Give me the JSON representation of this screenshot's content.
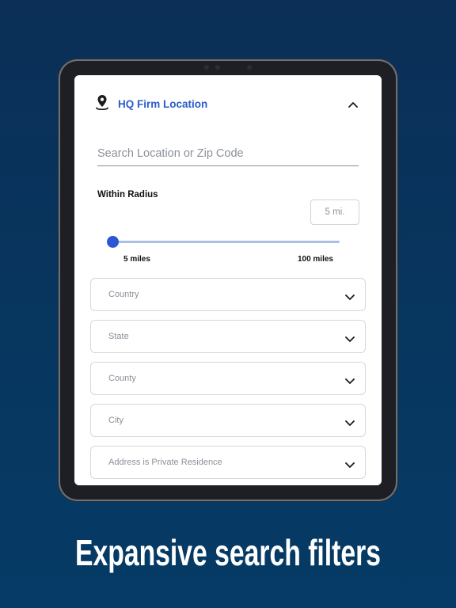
{
  "location": {
    "title": "HQ Firm Location",
    "search_placeholder": "Search Location or Zip Code",
    "radius_label": "Within Radius",
    "radius_value": "5 mi.",
    "slider_min_label": "5 miles",
    "slider_max_label": "100 miles",
    "slider_position_fraction": 0
  },
  "dropdowns": [
    {
      "label": "Country"
    },
    {
      "label": "State"
    },
    {
      "label": "County"
    },
    {
      "label": "City"
    },
    {
      "label": "Address is Private Residence"
    }
  ],
  "headline": "Expansive search filters",
  "icons": [
    "location-pin-icon",
    "chevron-up-icon",
    "chevron-down-icon"
  ],
  "colors": {
    "accent": "#2b5cc8",
    "slider_thumb": "#2b57d3",
    "background": "#07365f"
  }
}
